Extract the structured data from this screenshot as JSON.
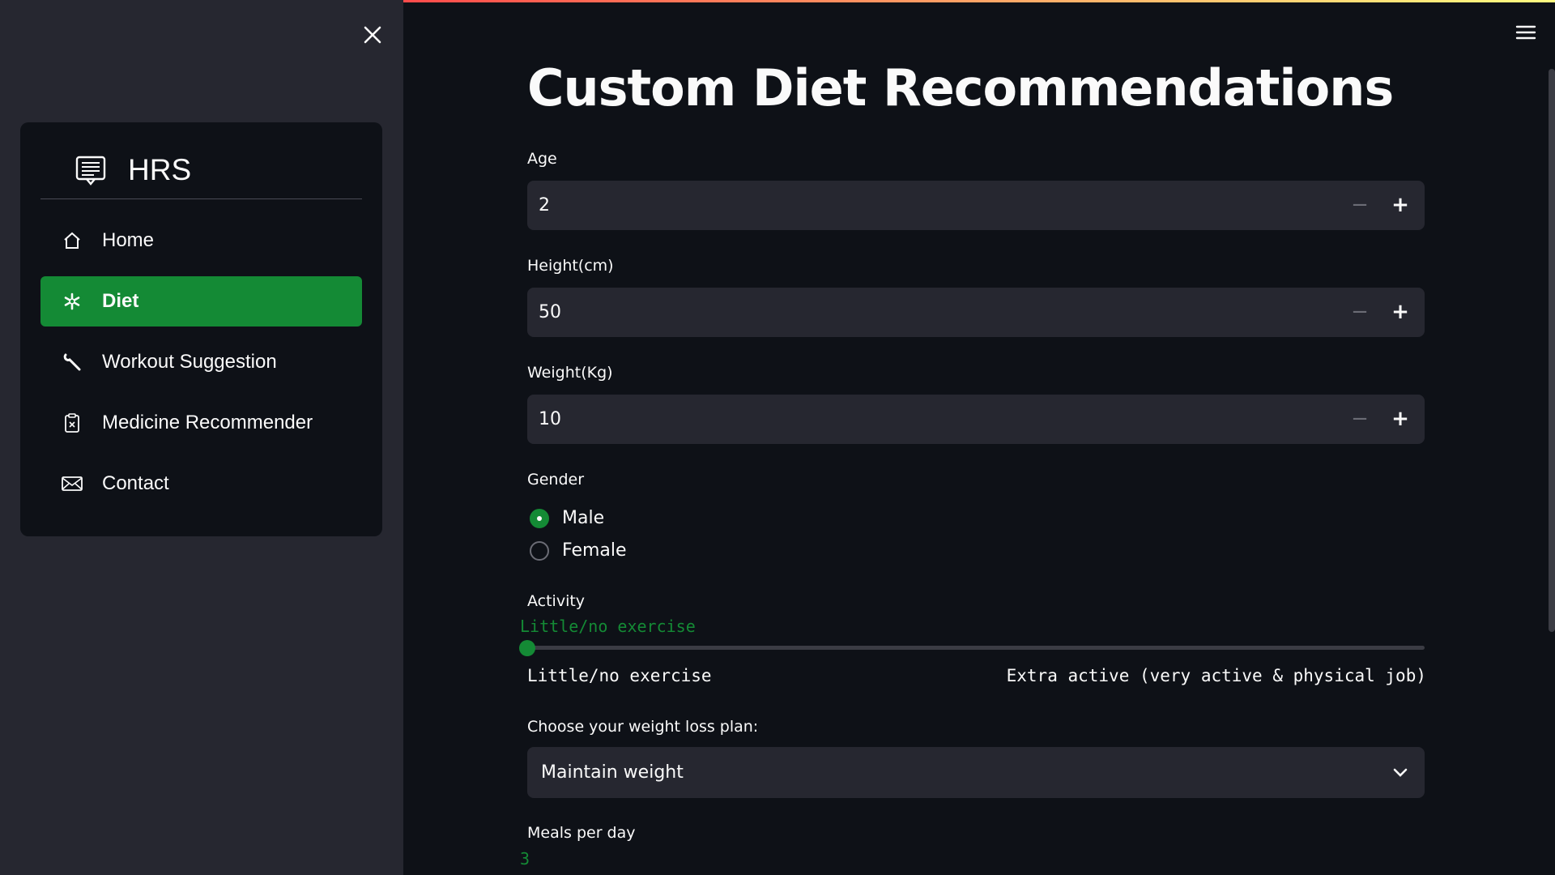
{
  "sidebar": {
    "title": "HRS",
    "items": [
      {
        "label": "Home",
        "icon": "house-icon"
      },
      {
        "label": "Diet",
        "icon": "asterisk-icon",
        "active": true
      },
      {
        "label": "Workout Suggestion",
        "icon": "wrench-icon"
      },
      {
        "label": "Medicine Recommender",
        "icon": "clipboard-x-icon"
      },
      {
        "label": "Contact",
        "icon": "envelope-icon"
      }
    ]
  },
  "main": {
    "title": "Custom Diet Recommendations",
    "age": {
      "label": "Age",
      "value": "2"
    },
    "height": {
      "label": "Height(cm)",
      "value": "50"
    },
    "weight": {
      "label": "Weight(Kg)",
      "value": "10"
    },
    "gender": {
      "label": "Gender",
      "options": [
        "Male",
        "Female"
      ],
      "selected": "Male"
    },
    "activity": {
      "label": "Activity",
      "current": "Little/no exercise",
      "min_label": "Little/no exercise",
      "max_label": "Extra active (very active & physical job)",
      "position": 0
    },
    "plan": {
      "label": "Choose your weight loss plan:",
      "value": "Maintain weight"
    },
    "meals": {
      "label": "Meals per day",
      "current": "3"
    }
  },
  "colors": {
    "accent": "#148a35",
    "background": "#0e1117",
    "sidebar": "#262730",
    "input": "#262730"
  }
}
